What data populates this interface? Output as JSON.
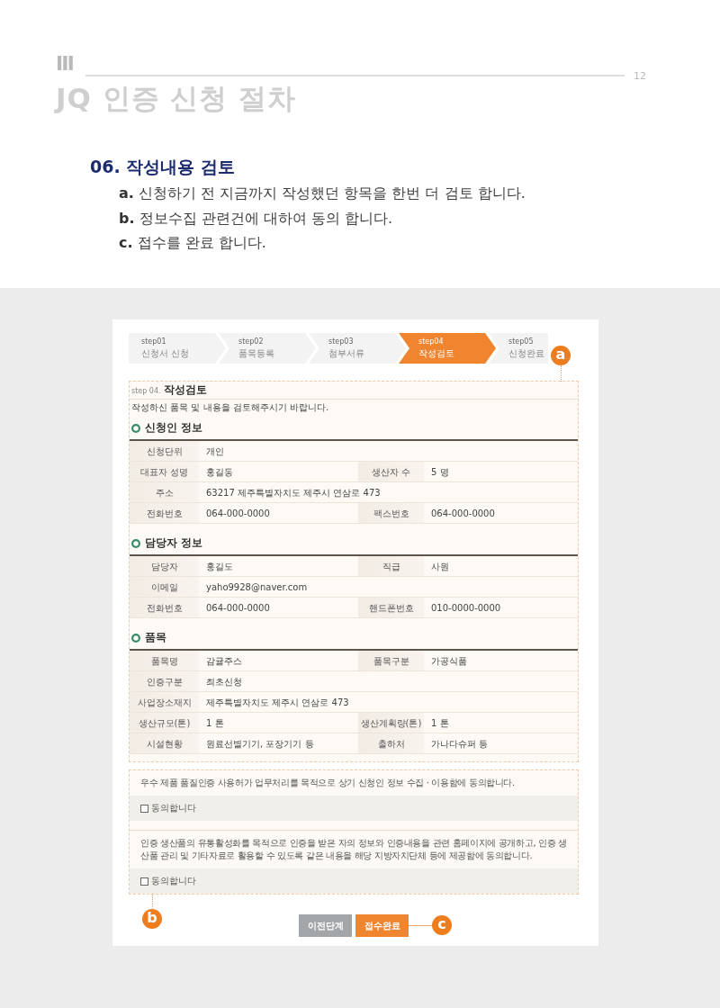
{
  "page_header": {
    "chapter": "Ⅲ",
    "page_number": "12",
    "title": "JQ 인증 신청 절차"
  },
  "section": {
    "heading": "06. 작성내용 검토",
    "items": [
      {
        "text": "**a.** 신청하기 전 지금까지 작성했던 항목을 한번 더 검토 합니다."
      },
      {
        "text": "**b.** 정보수집 관련건에 대하여 동의 합니다."
      },
      {
        "text": "**c.** 접수를 완료 합니다."
      }
    ]
  },
  "screenshot": {
    "steps": [
      {
        "number": "step01",
        "label": "신청서 신청",
        "selected": false
      },
      {
        "number": "step02",
        "label": "품목등록",
        "selected": false
      },
      {
        "number": "step03",
        "label": "첨부서류",
        "selected": false
      },
      {
        "number": "step04",
        "label": "작성검토",
        "selected": true
      },
      {
        "number": "step05",
        "label": "신청완료",
        "selected": false
      }
    ],
    "steps_callout": "a",
    "review": {
      "step_tag": "step 04.",
      "title": "작성검토",
      "description": "작성하신 품목 및 내용을 검토해주시기 바랍니다.",
      "sections": [
        {
          "title": "신청인 정보",
          "rows": [
            {
              "cells": [
                {
                  "label": "신청단위",
                  "value": "개인"
                }
              ]
            },
            {
              "cells": [
                {
                  "label": "대표자 성명",
                  "value": "홍길동"
                },
                {
                  "label": "생산자 수",
                  "value": "5 명"
                }
              ]
            },
            {
              "cells": [
                {
                  "label": "주소",
                  "value": "63217 제주특별자치도 제주시 연삼로 473"
                }
              ]
            },
            {
              "cells": [
                {
                  "label": "전화번호",
                  "value": "064-000-0000"
                },
                {
                  "label": "팩스번호",
                  "value": "064-000-0000"
                }
              ]
            }
          ]
        },
        {
          "title": "담당자 정보",
          "rows": [
            {
              "cells": [
                {
                  "label": "담당자",
                  "value": "홍길도"
                },
                {
                  "label": "직급",
                  "value": "사원"
                }
              ]
            },
            {
              "cells": [
                {
                  "label": "이메일",
                  "value": "yaho9928@naver.com"
                }
              ]
            },
            {
              "cells": [
                {
                  "label": "전화번호",
                  "value": "064-000-0000"
                },
                {
                  "label": "핸드폰번호",
                  "value": "010-0000-0000"
                }
              ]
            }
          ]
        },
        {
          "title": "품목",
          "rows": [
            {
              "cells": [
                {
                  "label": "품목명",
                  "value": "감귤주스"
                },
                {
                  "label": "품목구분",
                  "value": "가공식품"
                }
              ]
            },
            {
              "cells": [
                {
                  "label": "인증구분",
                  "value": "최초신청"
                }
              ]
            },
            {
              "cells": [
                {
                  "label": "사업장소재지",
                  "value": "제주특별자치도 제주시 연삼로 473"
                }
              ]
            },
            {
              "cells": [
                {
                  "label": "생산규모(톤)",
                  "value": "1 톤"
                },
                {
                  "label": "생산계획량(톤)",
                  "value": "1 톤"
                }
              ]
            },
            {
              "cells": [
                {
                  "label": "시설현황",
                  "value": "원료선별기기, 포장기기 등"
                },
                {
                  "label": "출하처",
                  "value": "가나다슈퍼 등"
                }
              ]
            }
          ]
        }
      ]
    },
    "consent": {
      "items": [
        {
          "text": "우수 제품 품질인증 사용허가 업무처리를 목적으로 상기 신청인 정보 수집 · 이용함에 동의합니다.",
          "checkbox_label": "동의합니다",
          "checked": false
        },
        {
          "text": "인증 생산품의 유통활성화를 목적으로 인증을 받은 자의 정보와 인증내용을 관련 홈페이지에 공개하고, 인증 생산품 관리 및 기타자료로 활용할 수 있도록 같은 내용을 해당 지방자치단체 등에 제공함에 동의합니다.",
          "checkbox_label": "동의합니다",
          "checked": false
        }
      ],
      "callout": "b"
    },
    "buttons": [
      {
        "label": "이전단계",
        "kind": "secondary"
      },
      {
        "label": "접수완료",
        "kind": "primary",
        "callout": "c"
      }
    ]
  }
}
